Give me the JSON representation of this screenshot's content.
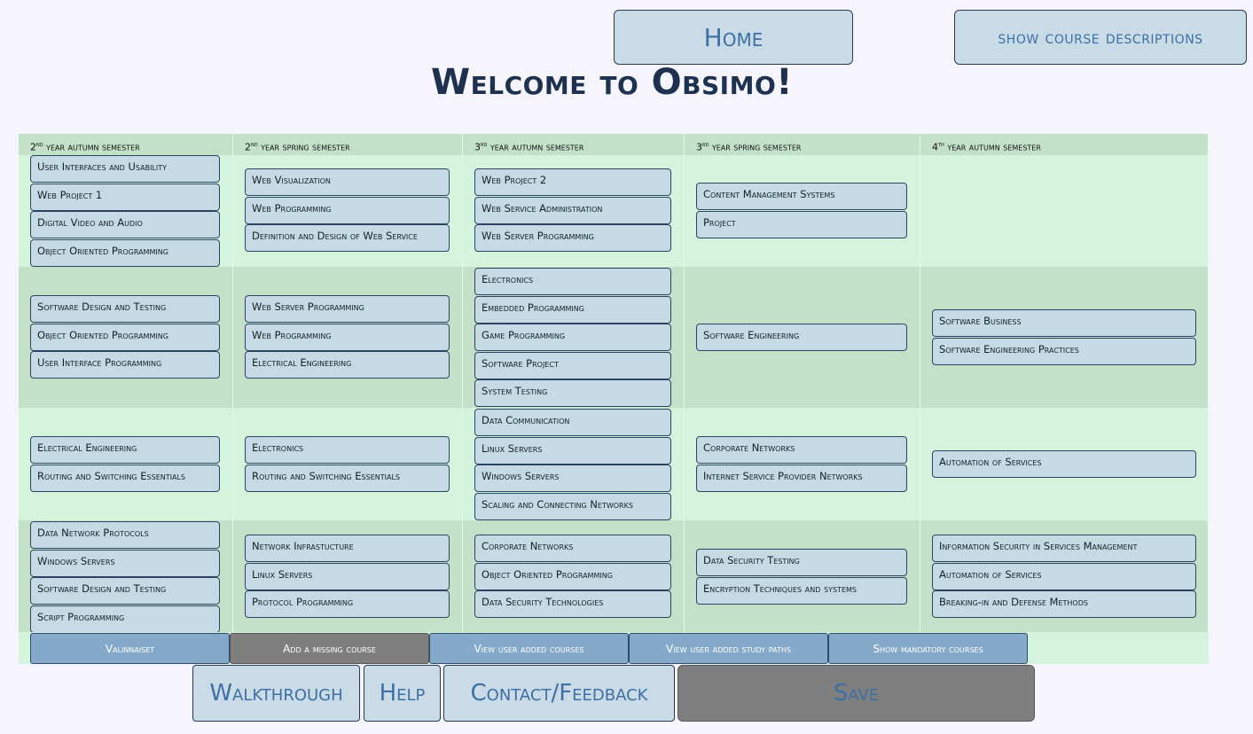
{
  "header": {
    "home_label": "Home",
    "show_descriptions_label": "show course descriptions",
    "title": "Welcome to Obsimo!"
  },
  "semesters": [
    {
      "num": "2",
      "sup": "nd",
      "label": "year autumn semester"
    },
    {
      "num": "2",
      "sup": "nd",
      "label": "year spring semester"
    },
    {
      "num": "3",
      "sup": "rd",
      "label": "year autumn semester"
    },
    {
      "num": "3",
      "sup": "rd",
      "label": "year spring semester"
    },
    {
      "num": "4",
      "sup": "th",
      "label": "year autumn semester"
    }
  ],
  "rows": [
    {
      "cells": [
        [
          "User Interfaces and Usability",
          "Web Project 1",
          "Digital Video and Audio",
          "Object Oriented Programming"
        ],
        [
          "Web Visualization",
          "Web Programming",
          "Definition and Design of Web Service"
        ],
        [
          "Web Project 2",
          "Web Service Administration",
          "Web Server Programming"
        ],
        [
          "Content Management Systems",
          "Project"
        ],
        []
      ]
    },
    {
      "cells": [
        [
          "Software Design and Testing",
          "Object Oriented Programming",
          "User Interface Programming"
        ],
        [
          "Web Server Programming",
          "Web Programming",
          "Electrical Engineering"
        ],
        [
          "Electronics",
          "Embedded Programming",
          "Game Programming",
          "Software Project",
          "System Testing"
        ],
        [
          "Software Engineering"
        ],
        [
          "Software Business",
          "Software Engineering Practices"
        ]
      ]
    },
    {
      "cells": [
        [
          "Electrical Engineering",
          "Routing and Switching Essentials"
        ],
        [
          "Electronics",
          "Routing and Switching Essentials"
        ],
        [
          "Data Communication",
          "Linux Servers",
          "Windows Servers",
          "Scaling and Connecting Networks"
        ],
        [
          "Corporate Networks",
          "Internet Service Provider Networks"
        ],
        [
          "Automation of Services"
        ]
      ]
    },
    {
      "cells": [
        [
          "Data Network Protocols",
          "Windows Servers",
          "Software Design and Testing",
          "Script Programming"
        ],
        [
          "Network Infrastucture",
          "Linux Servers",
          "Protocol Programming"
        ],
        [
          "Corporate Networks",
          "Object Oriented Programming",
          "Data Security Technologies"
        ],
        [
          "Data Security Testing",
          "Encryption Techniques and systems"
        ],
        [
          "Information Security in Services Management",
          "Automation of Services",
          "Breaking-in and Defense Methods"
        ]
      ]
    }
  ],
  "actions": [
    {
      "label": "Valinnaiset",
      "active": false
    },
    {
      "label": "Add a missing course",
      "active": true
    },
    {
      "label": "View user added courses",
      "active": false
    },
    {
      "label": "View user added study paths",
      "active": false
    },
    {
      "label": "Show mandatory courses",
      "active": false
    }
  ],
  "footer": {
    "walkthrough_label": "Walkthrough",
    "help_label": "Help",
    "contact_label": "Contact/Feedback",
    "save_label": "Save"
  },
  "colors": {
    "page_bg": "#f6f5fe",
    "button_bg": "#c8dbe7",
    "button_text": "#3f6fa4",
    "row_light": "#d5f4dd",
    "row_dark": "#c3e0c9",
    "action_bg": "#85a9c8",
    "disabled_grey": "#7f7f7f"
  }
}
